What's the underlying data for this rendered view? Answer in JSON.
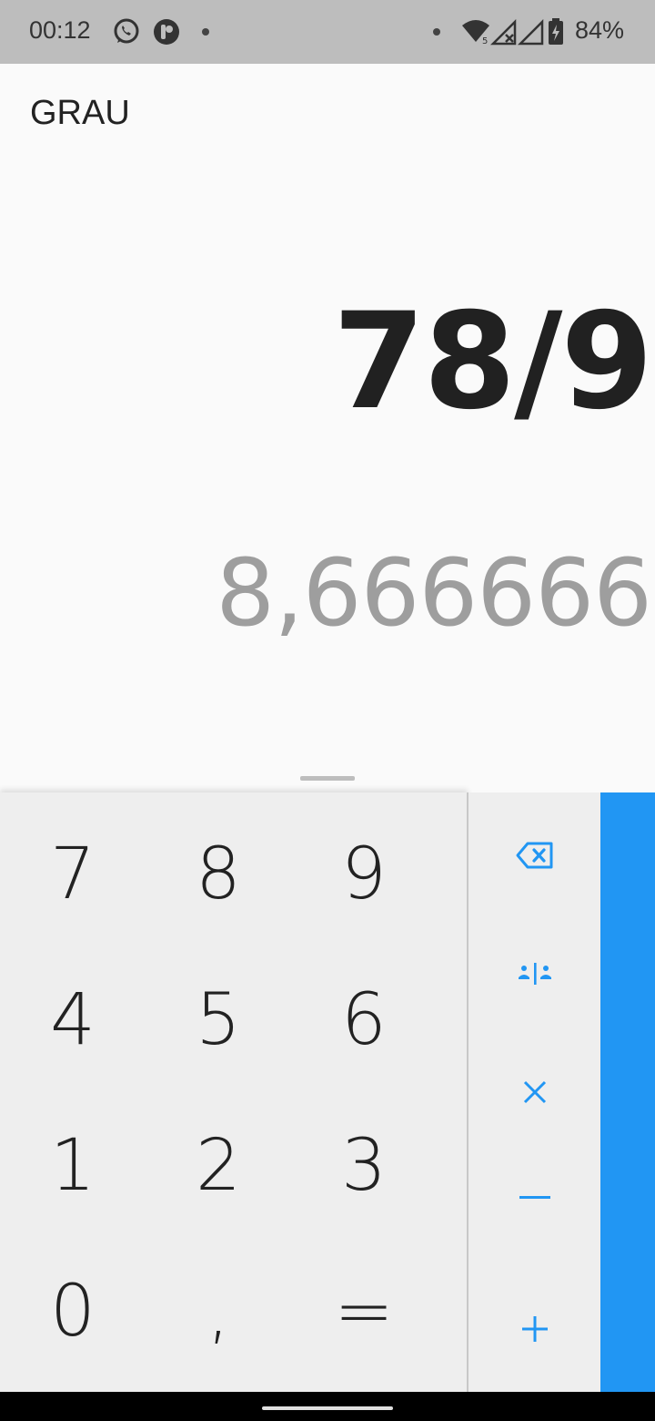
{
  "status_bar": {
    "time": "00:12",
    "battery": "84%",
    "icons": [
      "whatsapp-icon",
      "app-notification-icon",
      "dot-icon",
      "dot-icon",
      "wifi-icon",
      "signal-x-icon",
      "signal-icon",
      "battery-charging-icon"
    ]
  },
  "display": {
    "mode": "GRAU",
    "formula": "78/9",
    "result": "8,666666"
  },
  "keypad": {
    "keys": [
      "7",
      "8",
      "9",
      "4",
      "5",
      "6",
      "1",
      "2",
      "3",
      "0",
      ",",
      "="
    ]
  },
  "operators": [
    "backspace-icon",
    "divide-icon",
    "multiply-icon",
    "minus-icon",
    "plus-icon"
  ],
  "colors": {
    "accent": "#2196f3",
    "status_bar": "#bdbdbd",
    "keypad_bg": "#eeeeee",
    "result_text": "#9e9e9e"
  }
}
